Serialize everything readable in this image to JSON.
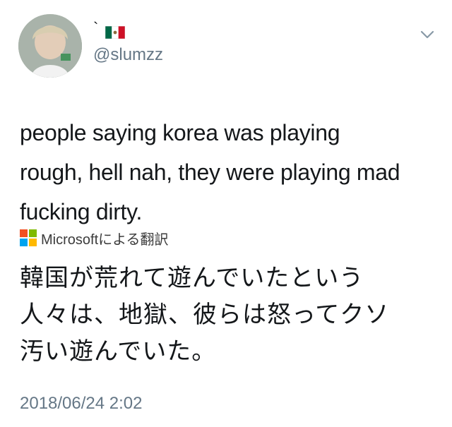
{
  "user": {
    "display_name_mark": "`",
    "flag_icon": "mexico-flag-icon",
    "handle": "@slumzz"
  },
  "tweet": {
    "text_lines": [
      "people saying korea was playing",
      "rough, hell nah, they were playing mad",
      "fucking dirty."
    ]
  },
  "translation": {
    "provider_label": "Microsoftによる翻訳",
    "logo_colors": [
      "#f25022",
      "#7fba00",
      "#00a4ef",
      "#ffb900"
    ],
    "text_lines": [
      "韓国が荒れて遊んでいたという",
      "人々は、地獄、彼らは怒ってクソ",
      "汚い遊んでいた。"
    ]
  },
  "timestamp": "2018/06/24 2:02"
}
